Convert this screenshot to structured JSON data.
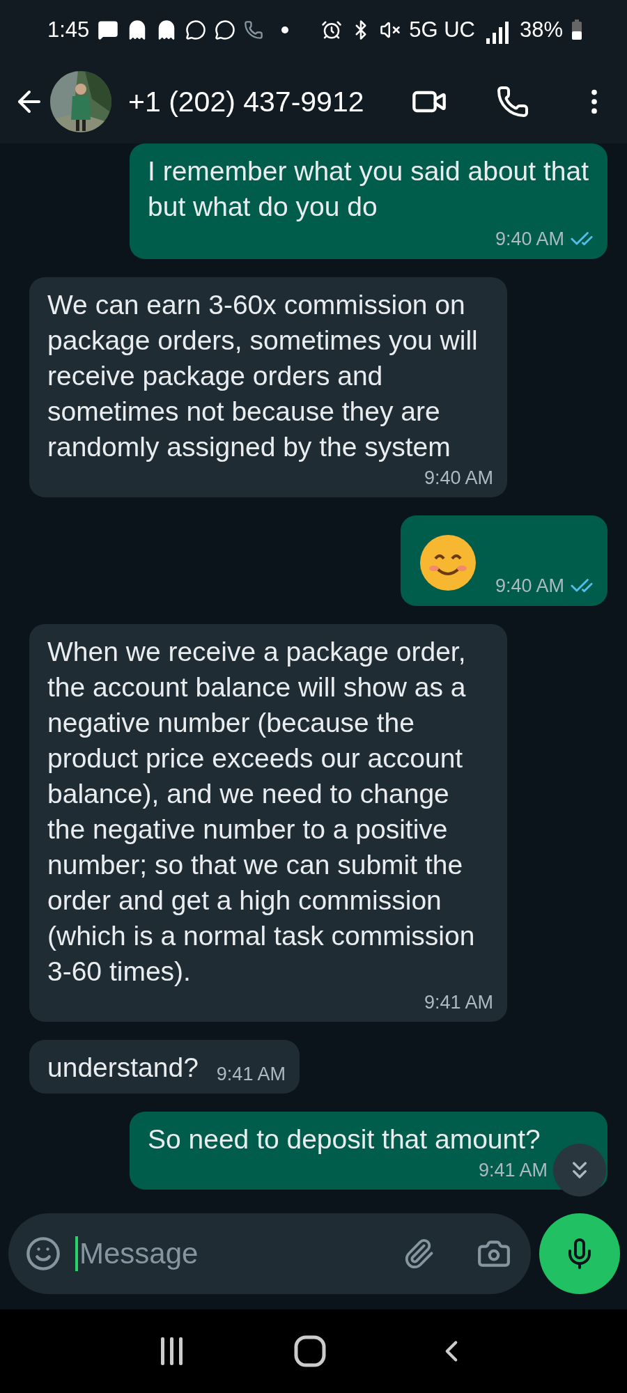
{
  "status_bar": {
    "time": "1:45",
    "network": "5G UC",
    "battery": "38%"
  },
  "header": {
    "contact": "+1 (202) 437-9912"
  },
  "messages": [
    {
      "kind": "text",
      "outgoing": true,
      "text": "I remember what you said about that but what do you do",
      "time": "9:40 AM",
      "read": true
    },
    {
      "kind": "text",
      "outgoing": false,
      "text": "We can earn 3-60x commission on package orders, sometimes you will receive package orders and sometimes not because they are randomly assigned by the system",
      "time": "9:40 AM"
    },
    {
      "kind": "emoji",
      "outgoing": true,
      "time": "9:40 AM",
      "read": true
    },
    {
      "kind": "text",
      "outgoing": false,
      "text": "When we receive a package order, the account balance will show as a negative number (because the product price exceeds our account balance), and we need to change the negative number to a positive number; so that we can submit the order and get a high commission (which is a normal task commission 3-60 times).",
      "time": "9:41 AM"
    },
    {
      "kind": "text",
      "outgoing": false,
      "text": "understand?",
      "time": "9:41 AM"
    },
    {
      "kind": "text",
      "outgoing": true,
      "text": "So need to deposit that amount?",
      "time": "9:41 AM"
    }
  ],
  "composer": {
    "placeholder": "Message"
  }
}
